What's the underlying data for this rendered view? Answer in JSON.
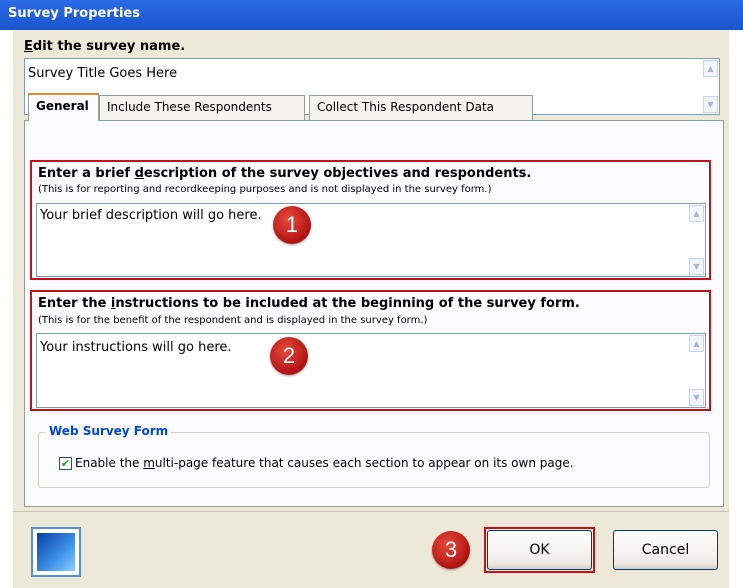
{
  "window": {
    "title": "Survey Properties"
  },
  "name_section": {
    "label_prefix": "",
    "label_accel": "E",
    "label_rest": "dit the survey name.",
    "value": "Survey Title Goes Here"
  },
  "tabs": [
    {
      "label": "General"
    },
    {
      "label": "Include These Respondents"
    },
    {
      "label": "Collect This Respondent Data"
    }
  ],
  "description": {
    "heading_pre": "Enter a brief ",
    "heading_accel": "d",
    "heading_post": "escription of the survey objectives and respondents.",
    "note": "(This is for reporting and recordkeeping purposes and is not displayed in the survey form.)",
    "value": "Your brief description will go here.",
    "badge": "1"
  },
  "instructions": {
    "heading_pre": "Enter the ",
    "heading_accel": "i",
    "heading_post": "nstructions to be included at the beginning of the survey form.",
    "note": "(This is for the benefit of the respondent and is displayed in the survey form.)",
    "value": "Your instructions will go here.",
    "badge": "2"
  },
  "web_form": {
    "legend": "Web Survey Form",
    "checkbox_pre": "Enable the ",
    "checkbox_accel": "m",
    "checkbox_post": "ulti-page feature that causes each section to appear on its own page.",
    "checked": true
  },
  "footer": {
    "ok_label": "OK",
    "cancel_label": "Cancel",
    "badge": "3"
  },
  "colors": {
    "title_bar": "#1a55cf",
    "highlight": "#c0121c",
    "legend": "#0046d5"
  }
}
